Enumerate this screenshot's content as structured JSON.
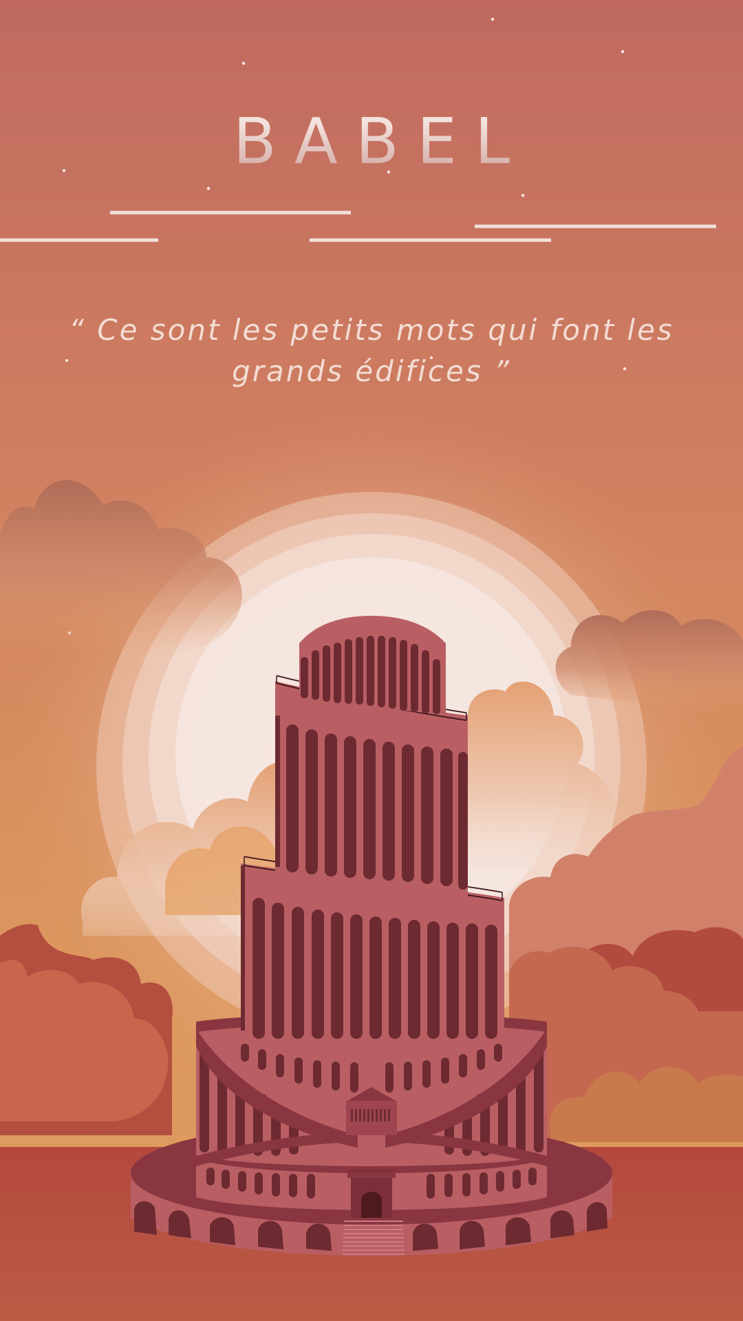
{
  "poster": {
    "title": "BABEL",
    "quote": "“ Ce sont les petits mots qui font les grands édifices ”"
  },
  "colors": {
    "sky_top": "#c06a60",
    "sky_mid": "#d4835f",
    "sky_bottom": "#df9b5e",
    "ground": "#b6503f",
    "tower_light": "#b95f64",
    "tower_dark": "#6e2a31",
    "cloud_red": "#b74f40",
    "cloud_orange": "#c8664c"
  },
  "icons": {
    "illustration": "tower-of-babel-illustration",
    "moon": "moon-halo",
    "clouds": "cloud-shapes",
    "stars": "star-dots"
  }
}
